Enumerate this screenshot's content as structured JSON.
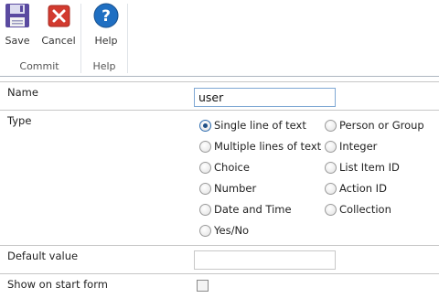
{
  "ribbon": {
    "save_label": "Save",
    "cancel_label": "Cancel",
    "help_label": "Help",
    "groups": {
      "commit": "Commit",
      "help": "Help"
    },
    "icons": {
      "save": "floppy-disk-icon",
      "cancel": "red-x-icon",
      "help": "question-mark-icon"
    },
    "colors": {
      "save": "#5a4aa0",
      "cancel": "#d23a2f",
      "help": "#1f6fc2"
    }
  },
  "form": {
    "name": {
      "label": "Name",
      "value": "user"
    },
    "type": {
      "label": "Type",
      "selected": "Single line of text",
      "options_left": [
        "Single line of text",
        "Multiple lines of text",
        "Choice",
        "Number",
        "Date and Time",
        "Yes/No"
      ],
      "options_right": [
        "Person or Group",
        "Integer",
        "List Item ID",
        "Action ID",
        "Collection"
      ]
    },
    "default_value": {
      "label": "Default value",
      "value": ""
    },
    "show_on_start": {
      "label": "Show on start form",
      "checked": false
    }
  }
}
